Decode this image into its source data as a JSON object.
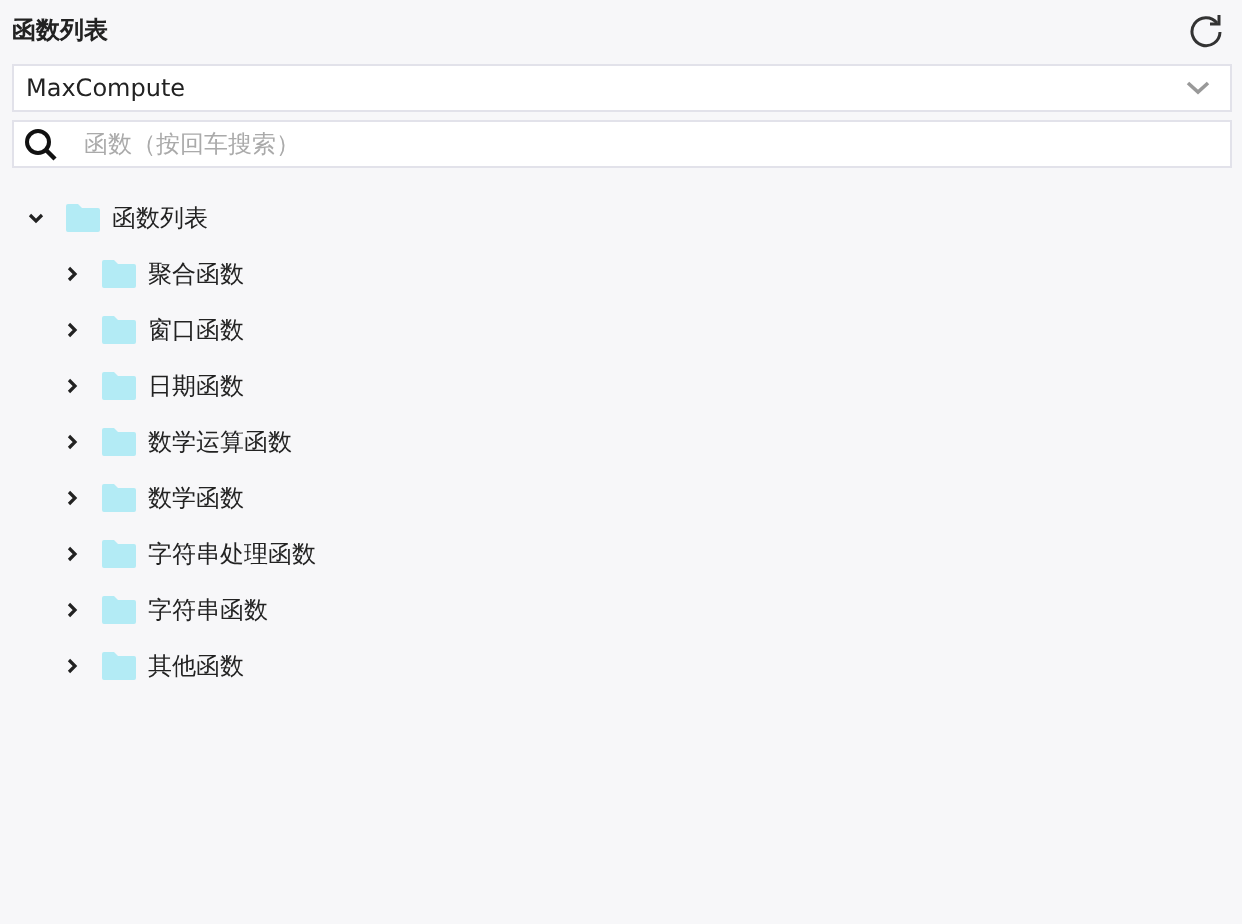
{
  "panel": {
    "title": "函数列表"
  },
  "source_select": {
    "value": "MaxCompute"
  },
  "search": {
    "placeholder": "函数（按回车搜索）"
  },
  "tree": [
    {
      "label": "函数列表",
      "expanded": true,
      "children": [
        {
          "label": "聚合函数",
          "expanded": false
        },
        {
          "label": "窗口函数",
          "expanded": false
        },
        {
          "label": "日期函数",
          "expanded": false
        },
        {
          "label": "数学运算函数",
          "expanded": false
        },
        {
          "label": "数学函数",
          "expanded": false
        },
        {
          "label": "字符串处理函数",
          "expanded": false
        },
        {
          "label": "字符串函数",
          "expanded": false
        },
        {
          "label": "其他函数",
          "expanded": false
        }
      ]
    }
  ]
}
